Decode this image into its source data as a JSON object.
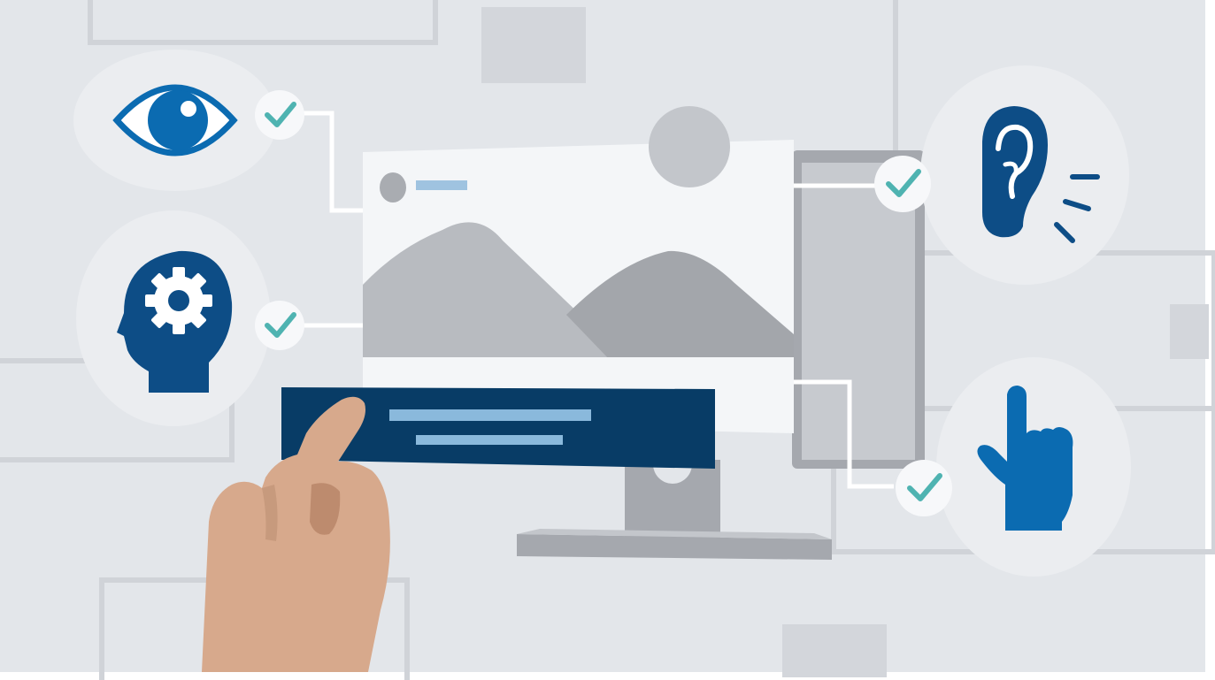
{
  "illustration": {
    "subject": "web-accessibility",
    "icons": [
      {
        "name": "eye-icon",
        "checked": true
      },
      {
        "name": "head-gear-icon",
        "checked": true
      },
      {
        "name": "ear-icon",
        "checked": true
      },
      {
        "name": "pointing-hand-icon",
        "checked": true
      }
    ],
    "colors": {
      "background": "#e3e6ea",
      "panel_light": "#d4d7dc",
      "icon_circle": "#ebedf0",
      "icon_blue": "#0b6bb1",
      "icon_navy": "#0d4d86",
      "check_teal": "#4fb3b1",
      "banner_navy": "#083c66",
      "banner_lines": "#8ab9dc",
      "monitor_gray": "#b3b6bb",
      "monitor_dark": "#9c9fa5",
      "mountain_light": "#b8bbc0",
      "mountain_dark": "#a3a6ab",
      "skin": "#d7a98c",
      "skin_shadow": "#bd8b6e"
    }
  }
}
